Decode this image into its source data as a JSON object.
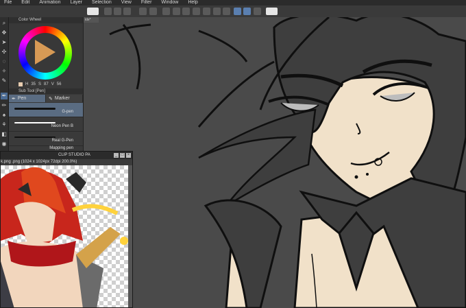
{
  "menu": [
    "File",
    "Edit",
    "Animation",
    "Layer",
    "Selection",
    "View",
    "Filter",
    "Window",
    "Help"
  ],
  "palette": {
    "title": "Color Wheel",
    "readout": [
      "H",
      "35",
      "S",
      "87",
      "V",
      "56"
    ],
    "main_color": "#e8cdb0",
    "sub_color": "#ffffff"
  },
  "subtool": {
    "title": "Sub Tool [Pen]",
    "tabs": [
      "Pen",
      "Marker"
    ],
    "brushes": [
      "G-pen",
      "Neon Pen B",
      "Real G-Pen",
      "Mapping pen"
    ]
  },
  "canvas": {
    "tab": "ide*"
  },
  "subview": {
    "title": "CLIP STUDIO PA",
    "info": ".png (1024 x 1024px 72dpi 200.0%)",
    "caption": "k.png"
  },
  "colors": {
    "skin": "#f1e1c9",
    "line": "#0f0f0f",
    "hair": "#3e3e3e",
    "accent": "#4b6b93"
  }
}
